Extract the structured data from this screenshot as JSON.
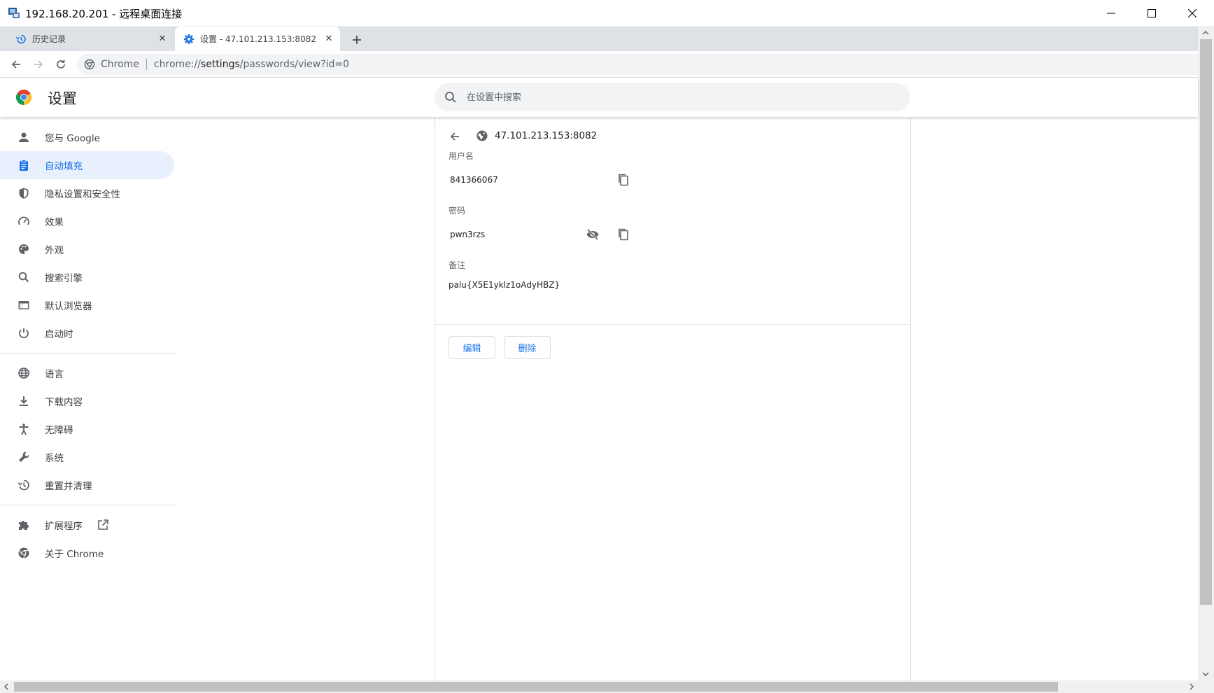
{
  "window": {
    "title": "192.168.20.201 - 远程桌面连接",
    "icon": "remote-desktop-icon"
  },
  "tabs": [
    {
      "title": "历史记录",
      "icon": "history-icon",
      "active": false
    },
    {
      "title": "设置 - 47.101.213.153:8082",
      "icon": "settings-gear-icon",
      "active": true
    }
  ],
  "toolbar": {
    "chip_label": "Chrome",
    "url_scheme": "chrome://",
    "url_host": "settings",
    "url_path": "/passwords/view?id=0"
  },
  "header": {
    "title": "设置",
    "search_placeholder": "在设置中搜索"
  },
  "sidebar": {
    "items": [
      {
        "label": "您与 Google",
        "icon": "person-icon"
      },
      {
        "label": "自动填充",
        "icon": "clipboard-icon",
        "selected": true
      },
      {
        "label": "隐私设置和安全性",
        "icon": "shield-icon"
      },
      {
        "label": "效果",
        "icon": "speedometer-icon"
      },
      {
        "label": "外观",
        "icon": "palette-icon"
      },
      {
        "label": "搜索引擎",
        "icon": "search-icon"
      },
      {
        "label": "默认浏览器",
        "icon": "browser-icon"
      },
      {
        "label": "启动时",
        "icon": "power-icon"
      },
      {
        "label": "语言",
        "icon": "globe-icon"
      },
      {
        "label": "下载内容",
        "icon": "download-icon"
      },
      {
        "label": "无障碍",
        "icon": "accessibility-icon"
      },
      {
        "label": "系统",
        "icon": "wrench-icon"
      },
      {
        "label": "重置并清理",
        "icon": "reset-icon"
      },
      {
        "label": "扩展程序",
        "icon": "puzzle-icon"
      },
      {
        "label": "关于 Chrome",
        "icon": "chrome-icon"
      }
    ]
  },
  "password_entry": {
    "site": "47.101.213.153:8082",
    "username_label": "用户名",
    "username": "841366067",
    "password_label": "密码",
    "password": "pwn3rzs",
    "note_label": "备注",
    "note": "palu{X5E1yklz1oAdyHBZ}",
    "edit_label": "编辑",
    "delete_label": "删除"
  },
  "colors": {
    "accent": "#1a73e8",
    "selected_bg": "#e8f0fe",
    "tabstrip_bg": "#dee1e6"
  }
}
